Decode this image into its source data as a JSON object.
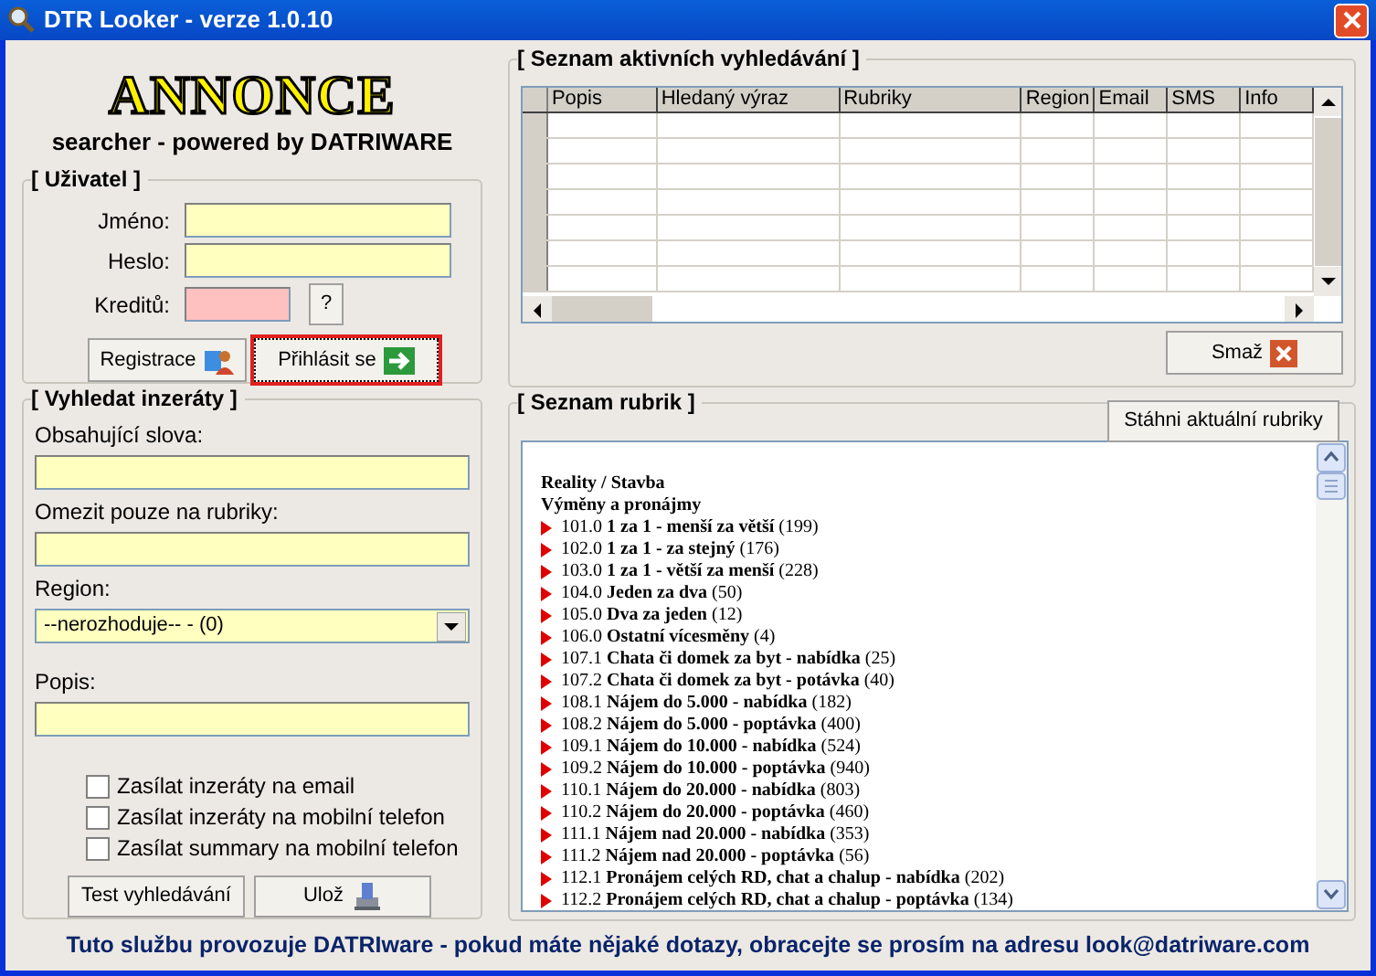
{
  "window": {
    "title": "DTR Looker - verze 1.0.10"
  },
  "logo": {
    "title": "ANNONCE",
    "subtitle": "searcher - powered by DATRIWARE"
  },
  "user": {
    "title": "[ Uživatel ]",
    "fields": [
      {
        "label": "Jméno:",
        "kind": "text"
      },
      {
        "label": "Heslo:",
        "kind": "text"
      },
      {
        "label": "Kreditů:",
        "kind": "credit",
        "button": "?"
      }
    ],
    "buttons": [
      {
        "label": "Registrace",
        "kind": "register",
        "focused": false
      },
      {
        "label": "Přihlásit se",
        "kind": "login",
        "focused": true
      }
    ]
  },
  "search": {
    "title": "[ Vyhledat inzeráty ]",
    "fields": [
      {
        "label": "Obsahující slova:",
        "kind": "text"
      },
      {
        "label": "Omezit pouze na rubriky:",
        "kind": "text"
      },
      {
        "label": "Region:",
        "kind": "select",
        "value": "--nerozhoduje-- - (0)"
      },
      {
        "label": "Popis:",
        "kind": "text"
      }
    ],
    "checkboxes": [
      {
        "label": "Zasílat inzeráty na email",
        "checked": false
      },
      {
        "label": "Zasílat inzeráty na mobilní telefon",
        "checked": false
      },
      {
        "label": "Zasílat summary na mobilní telefon",
        "checked": false
      }
    ],
    "buttons": [
      {
        "label": "Test vyhledávání",
        "kind": "test"
      },
      {
        "label": "Ulož",
        "kind": "save"
      }
    ]
  },
  "active_searches": {
    "title": "[ Seznam aktivních vyhledávání ]",
    "columns": [
      "Popis",
      "Hledaný výraz",
      "Rubriky",
      "Region",
      "Email",
      "SMS",
      "Info"
    ],
    "delete_button": "Smaž"
  },
  "rubrics": {
    "title": "[ Seznam rubrik ]",
    "download_button": "Stáhni aktuální rubriky",
    "items": [
      {
        "kind": "heading",
        "name": "Reality / Stavba"
      },
      {
        "kind": "heading",
        "name": "Výměny a pronájmy"
      },
      {
        "kind": "item",
        "code": "101.0",
        "name": "1 za 1 - menší za větší",
        "count": "(199)"
      },
      {
        "kind": "item",
        "code": "102.0",
        "name": "1 za 1 - za stejný",
        "count": "(176)"
      },
      {
        "kind": "item",
        "code": "103.0",
        "name": "1 za 1 - větší za menší",
        "count": "(228)"
      },
      {
        "kind": "item",
        "code": "104.0",
        "name": "Jeden za dva",
        "count": "(50)"
      },
      {
        "kind": "item",
        "code": "105.0",
        "name": "Dva za jeden",
        "count": "(12)"
      },
      {
        "kind": "item",
        "code": "106.0",
        "name": "Ostatní vícesměny",
        "count": "(4)"
      },
      {
        "kind": "item",
        "code": "107.1",
        "name": "Chata či domek za byt - nabídka",
        "count": "(25)"
      },
      {
        "kind": "item",
        "code": "107.2",
        "name": "Chata či domek za byt - potávka",
        "count": "(40)"
      },
      {
        "kind": "item",
        "code": "108.1",
        "name": "Nájem do 5.000 - nabídka",
        "count": "(182)"
      },
      {
        "kind": "item",
        "code": "108.2",
        "name": "Nájem do 5.000 - poptávka",
        "count": "(400)"
      },
      {
        "kind": "item",
        "code": "109.1",
        "name": "Nájem do 10.000 - nabídka",
        "count": "(524)"
      },
      {
        "kind": "item",
        "code": "109.2",
        "name": "Nájem do 10.000 - poptávka",
        "count": "(940)"
      },
      {
        "kind": "item",
        "code": "110.1",
        "name": "Nájem do 20.000 - nabídka",
        "count": "(803)"
      },
      {
        "kind": "item",
        "code": "110.2",
        "name": "Nájem do 20.000 - poptávka",
        "count": "(460)"
      },
      {
        "kind": "item",
        "code": "111.1",
        "name": "Nájem nad 20.000 - nabídka",
        "count": "(353)"
      },
      {
        "kind": "item",
        "code": "111.2",
        "name": "Nájem nad 20.000 - poptávka",
        "count": "(56)"
      },
      {
        "kind": "item",
        "code": "112.1",
        "name": "Pronájem celých RD, chat a chalup - nabídka",
        "count": "(202)"
      },
      {
        "kind": "item",
        "code": "112.2",
        "name": "Pronájem celých RD, chat a chalup - poptávka",
        "count": "(134)"
      }
    ]
  },
  "footer": "Tuto službu provozuje DATRIware - pokud máte nějaké dotazy, obracejte se prosím na adresu look@datriware.com"
}
